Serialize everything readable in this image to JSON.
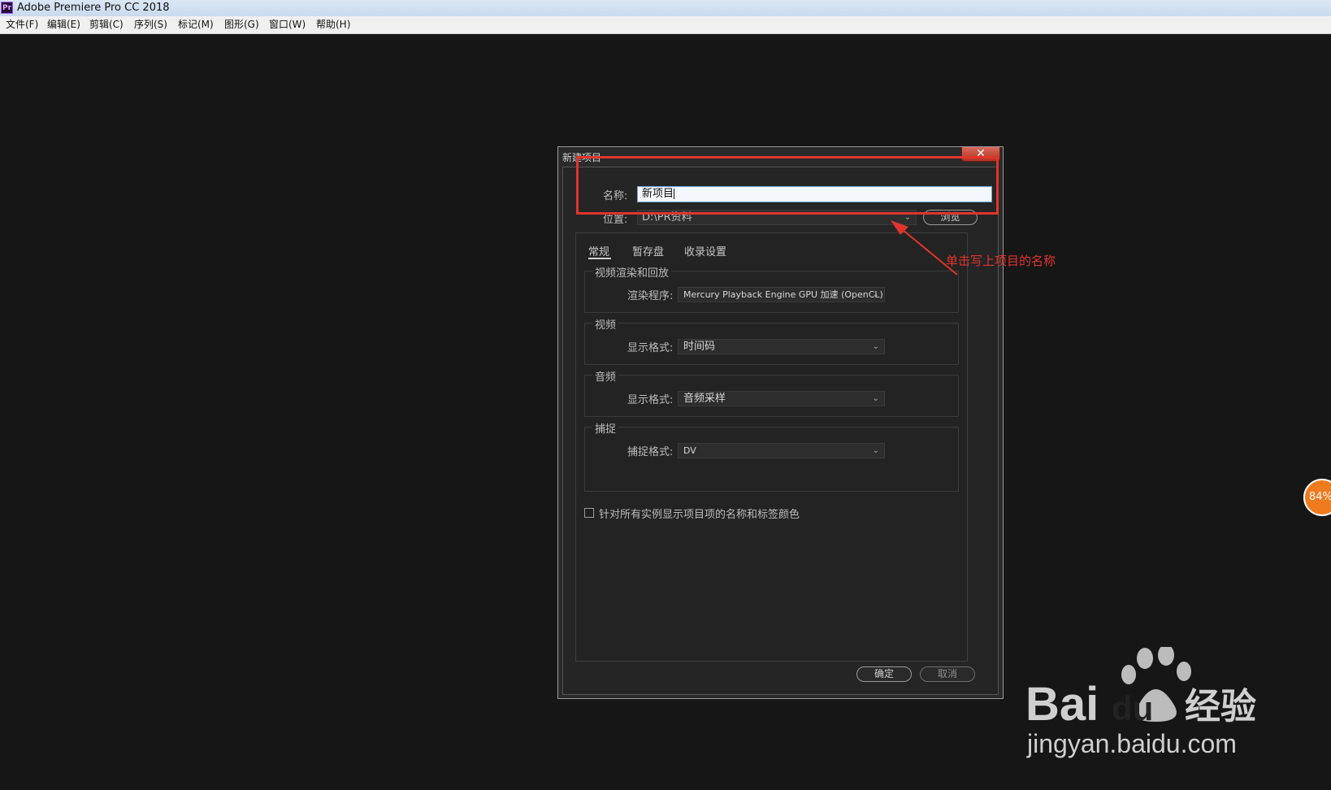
{
  "app": {
    "title": "Adobe Premiere Pro CC 2018",
    "icon_text": "Pr",
    "icon_name": "premiere-pro-icon"
  },
  "menu": [
    "文件(F)",
    "编辑(E)",
    "剪辑(C)",
    "序列(S)",
    "标记(M)",
    "图形(G)",
    "窗口(W)",
    "帮助(H)"
  ],
  "dialog": {
    "title": "新建项目",
    "close_label": "✕",
    "name_label": "名称:",
    "name_value": "新项目",
    "location_label": "位置:",
    "location_value": "D:\\PR资料",
    "browse_label": "浏览",
    "tabs": [
      "常规",
      "暂存盘",
      "收录设置"
    ],
    "active_tab": "常规",
    "groups": {
      "render": {
        "title": "视频渲染和回放",
        "field": "渲染程序:",
        "value": "Mercury Playback Engine GPU 加速 (OpenCL)"
      },
      "video": {
        "title": "视频",
        "field": "显示格式:",
        "value": "时间码"
      },
      "audio": {
        "title": "音频",
        "field": "显示格式:",
        "value": "音频采样"
      },
      "capture": {
        "title": "捕捉",
        "field": "捕捉格式:",
        "value": "DV"
      }
    },
    "checkbox_label": "针对所有实例显示项目项的名称和标签颜色",
    "checkbox_checked": false,
    "ok_label": "确定",
    "cancel_label": "取消"
  },
  "annotation": {
    "text": "单击写上项目的名称",
    "color": "#e0342c"
  },
  "badge": {
    "text": "84%",
    "color": "#f07a1e"
  },
  "watermark": {
    "brand": "Bai",
    "brand2": "du",
    "cn": "经验",
    "url": "jingyan.baidu.com"
  }
}
